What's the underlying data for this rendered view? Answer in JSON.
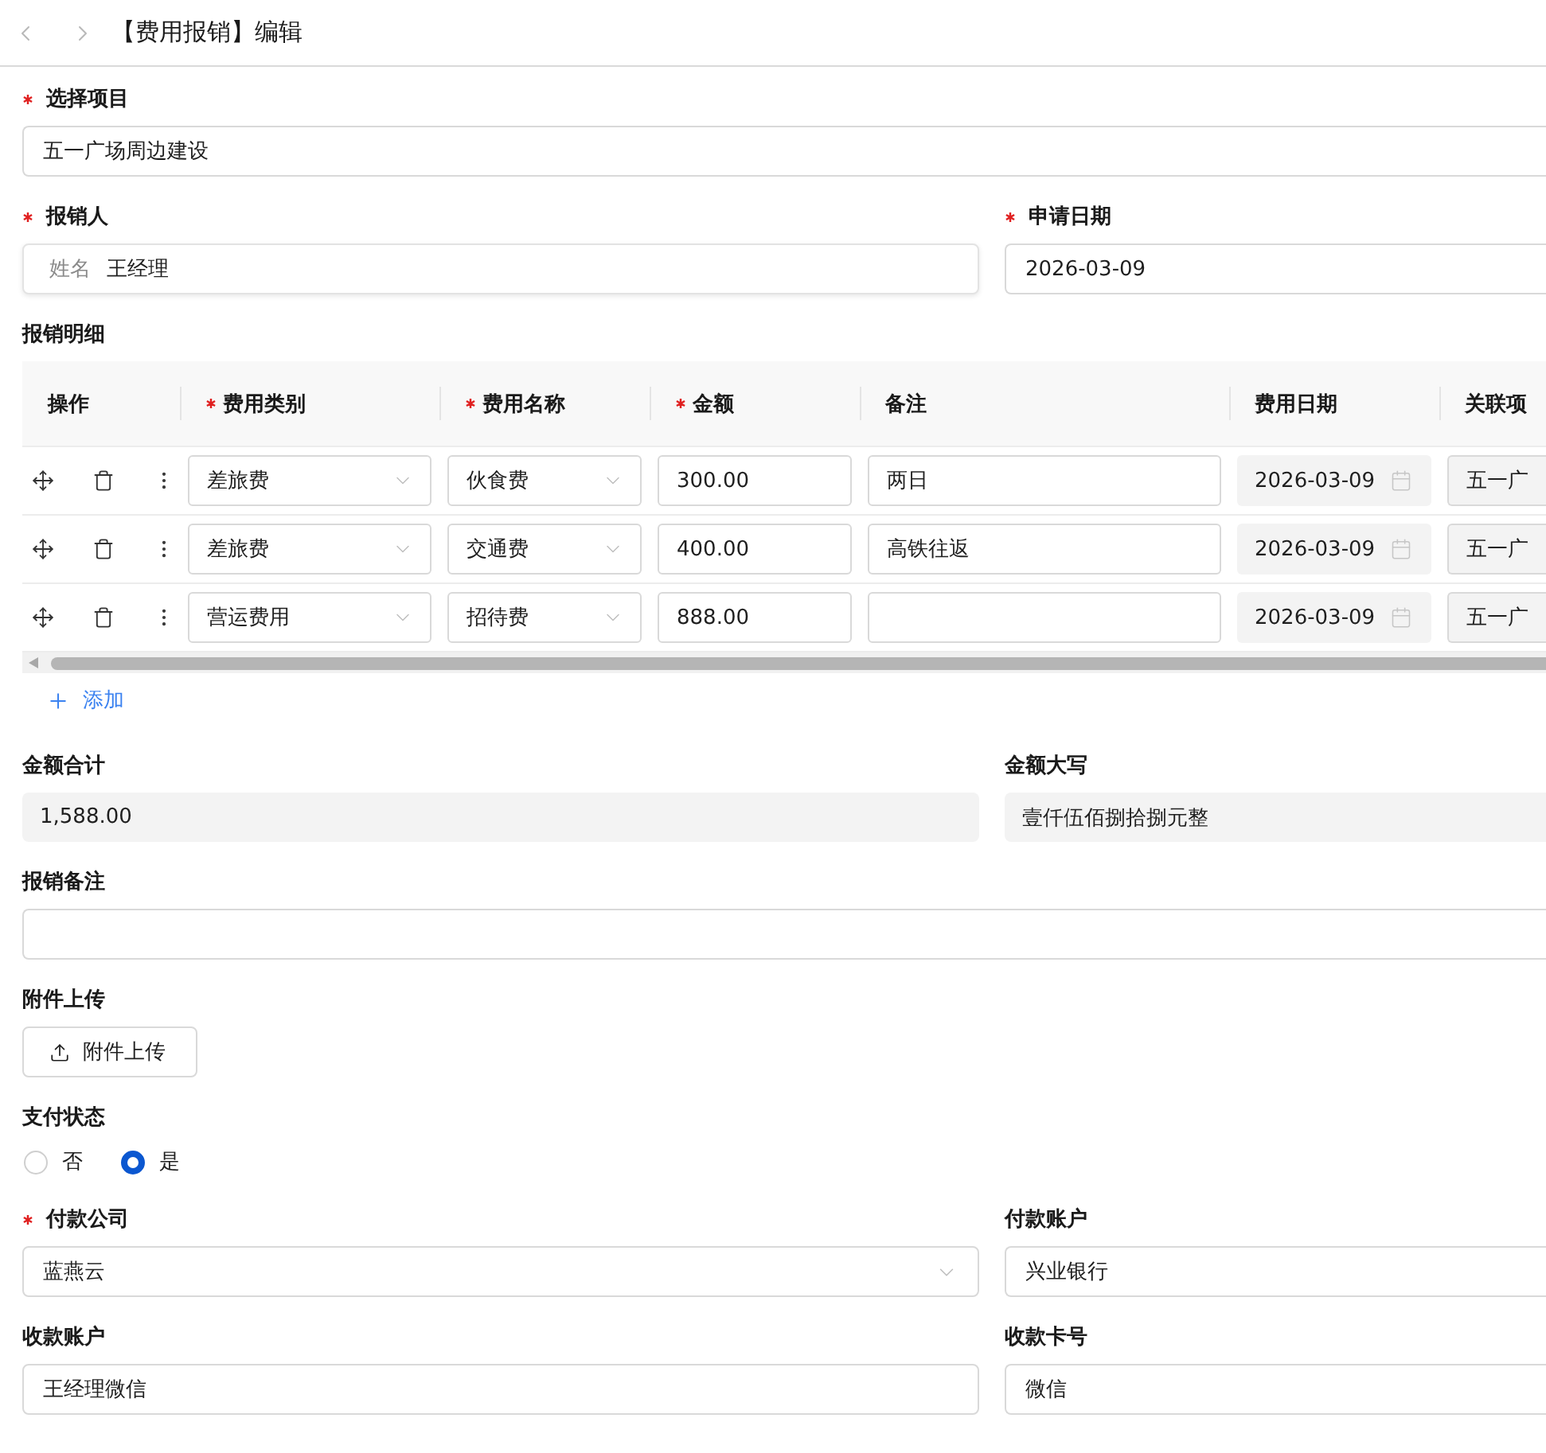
{
  "header": {
    "title": "【费用报销】编辑"
  },
  "form": [
    {
      "fields": [
        {
          "kind": "input",
          "label": "选择项目",
          "required": true,
          "value": "五一广场周边建设"
        }
      ]
    },
    {
      "fields": [
        {
          "kind": "input",
          "label": "报销人",
          "required": true,
          "prefix": "姓名",
          "value": "王经理"
        },
        {
          "kind": "input",
          "label": "申请日期",
          "required": true,
          "value": "2026-03-09"
        }
      ]
    },
    {
      "fields": [
        {
          "kind": "table",
          "label": "报销明细",
          "required": false,
          "action_column": "操作",
          "columns": [
            {
              "label": "费用类别",
              "kind": "select",
              "required": true
            },
            {
              "label": "费用名称",
              "kind": "select",
              "required": true
            },
            {
              "label": "金额",
              "kind": "input",
              "required": true
            },
            {
              "label": "备注",
              "kind": "input",
              "required": false
            },
            {
              "label": "费用日期",
              "kind": "date",
              "required": false
            },
            {
              "label": "关联项",
              "kind": "locked",
              "required": false
            }
          ],
          "rows": [
            {
              "cells": [
                "差旅费",
                "伙食费",
                "300.00",
                "两日",
                "2026-03-09",
                "五一广"
              ]
            },
            {
              "cells": [
                "差旅费",
                "交通费",
                "400.00",
                "高铁往返",
                "2026-03-09",
                "五一广"
              ]
            },
            {
              "cells": [
                "营运费用",
                "招待费",
                "888.00",
                null,
                "2026-03-09",
                "五一广"
              ]
            }
          ],
          "add_label": "添加"
        }
      ]
    },
    {
      "fields": [
        {
          "kind": "readonly",
          "label": "金额合计",
          "required": false,
          "value": "1,588.00"
        },
        {
          "kind": "readonly",
          "label": "金额大写",
          "required": false,
          "value": "壹仟伍佰捌拾捌元整"
        }
      ]
    },
    {
      "fields": [
        {
          "kind": "input",
          "label": "报销备注",
          "required": false
        }
      ]
    },
    {
      "fields": [
        {
          "kind": "upload",
          "label": "附件上传",
          "required": false,
          "button": "附件上传"
        }
      ]
    },
    {
      "fields": [
        {
          "kind": "radio",
          "label": "支付状态",
          "required": false,
          "options": [
            {
              "label": "否",
              "selected": false
            },
            {
              "label": "是",
              "selected": true
            }
          ]
        }
      ]
    },
    {
      "fields": [
        {
          "kind": "select",
          "label": "付款公司",
          "required": true,
          "value": "蓝燕云"
        },
        {
          "kind": "input",
          "label": "付款账户",
          "required": false,
          "value": "兴业银行"
        }
      ]
    },
    {
      "fields": [
        {
          "kind": "input",
          "label": "收款账户",
          "required": false,
          "value": "王经理微信"
        },
        {
          "kind": "input",
          "label": "收款卡号",
          "required": false,
          "value": "微信"
        }
      ]
    }
  ]
}
